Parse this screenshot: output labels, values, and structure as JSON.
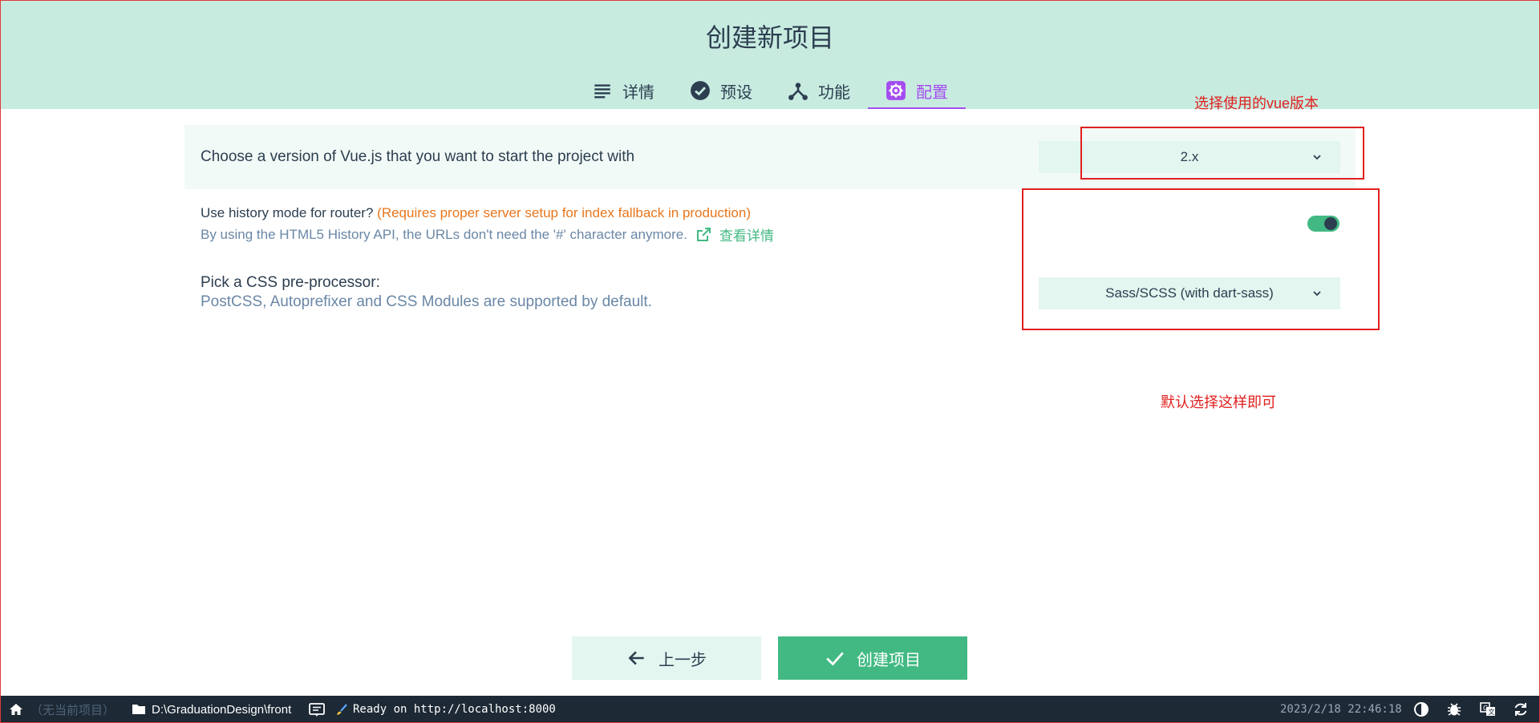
{
  "header": {
    "title": "创建新项目",
    "tabs": [
      {
        "label": "详情",
        "icon": "list-icon"
      },
      {
        "label": "预设",
        "icon": "check-circle-icon"
      },
      {
        "label": "功能",
        "icon": "fork-icon"
      },
      {
        "label": "配置",
        "icon": "gear-icon"
      }
    ],
    "active_tab": "配置"
  },
  "config": {
    "vue_version": {
      "label": "Choose a version of Vue.js that you want to start the project with",
      "value": "2.x"
    },
    "history_mode": {
      "label": "Use history mode for router?",
      "warning": "(Requires proper server setup for index fallback in production)",
      "description": "By using the HTML5 History API, the URLs don't need the '#' character anymore.",
      "link_label": "查看详情",
      "enabled": true
    },
    "css_preprocessor": {
      "label": "Pick a CSS pre-processor:",
      "description": "PostCSS, Autoprefixer and CSS Modules are supported by default.",
      "value": "Sass/SCSS (with dart-sass)"
    }
  },
  "annotations": {
    "vue_version_note": "选择使用的vue版本",
    "default_note": "默认选择这样即可",
    "color": "#e02020"
  },
  "actions": {
    "back_label": "上一步",
    "create_label": "创建项目"
  },
  "statusbar": {
    "project": "（无当前项目）",
    "path": "D:\\GraduationDesign\\front",
    "log": "Ready on http://localhost:8000",
    "datetime": "2023/2/18 22:46:18"
  },
  "colors": {
    "header_bg": "#c8ebe0",
    "accent_green": "#42b983",
    "accent_purple": "#a44cf0",
    "statusbar_bg": "#1d2935"
  }
}
